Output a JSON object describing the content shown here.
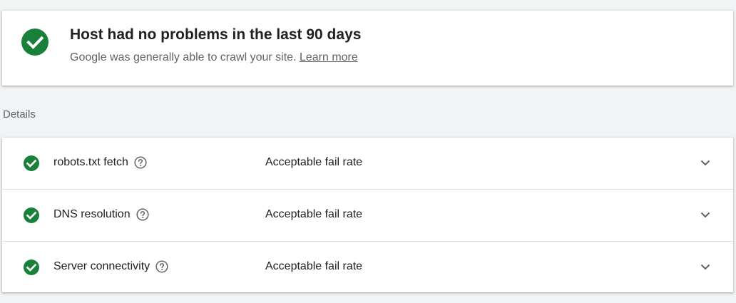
{
  "summary": {
    "title": "Host had no problems in the last 90 days",
    "description": "Google was generally able to crawl your site.",
    "link_label": "Learn more",
    "icon": "check-circle-icon",
    "status_color": "#188038"
  },
  "details": {
    "heading": "Details",
    "rows": [
      {
        "label": "robots.txt fetch",
        "status": "Acceptable fail rate",
        "icon": "check-circle-icon"
      },
      {
        "label": "DNS resolution",
        "status": "Acceptable fail rate",
        "icon": "check-circle-icon"
      },
      {
        "label": "Server connectivity",
        "status": "Acceptable fail rate",
        "icon": "check-circle-icon"
      }
    ]
  }
}
